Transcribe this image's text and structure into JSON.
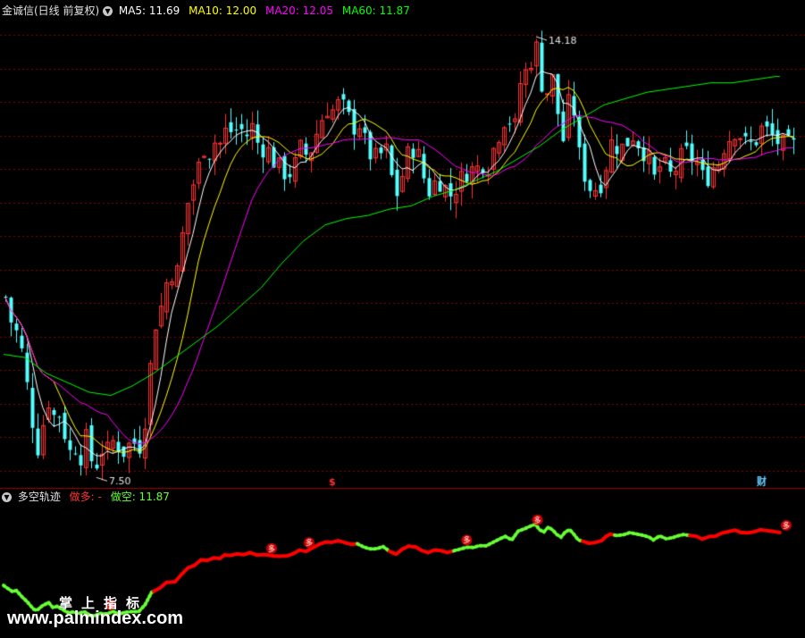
{
  "header": {
    "stock": "金诚信(日线 前复权)",
    "ma5": "MA5: 11.69",
    "ma10": "MA10: 12.00",
    "ma20": "MA20: 12.05",
    "ma60": "MA60: 11.87"
  },
  "indicator": {
    "name": "多空轨迹",
    "long_label": "做多: -",
    "short_label": "做空: 11.87"
  },
  "watermark": {
    "line1": "掌上指标",
    "line2": "www.palmindex.com"
  },
  "colors": {
    "up": "#ff3232",
    "down": "#54ffff",
    "ma5": "#ffffff",
    "ma10": "#ffff00",
    "ma20": "#ff00ff",
    "ma60": "#00ff00",
    "grid": "#8b0000",
    "long_line": "#ff0000",
    "short_line": "#66ff33"
  },
  "chart_data": {
    "type": "candlestick",
    "y_range": [
      7.2,
      14.6
    ],
    "max_label": "14.18",
    "min_label": "7.50",
    "markers": [
      "$",
      "财"
    ],
    "signal_label": "多",
    "price_control_points": [
      [
        0,
        10.2
      ],
      [
        8,
        9.6
      ],
      [
        12,
        9.7
      ],
      [
        17,
        9.1
      ],
      [
        22,
        8.6
      ],
      [
        28,
        7.9
      ],
      [
        31,
        7.8
      ],
      [
        36,
        8.3
      ],
      [
        42,
        8.7
      ],
      [
        46,
        8.2
      ],
      [
        50,
        8.35
      ],
      [
        55,
        8.05
      ],
      [
        60,
        7.75
      ],
      [
        65,
        7.85
      ],
      [
        70,
        7.7
      ],
      [
        75,
        7.95
      ],
      [
        82,
        7.5
      ],
      [
        86,
        7.6
      ],
      [
        90,
        7.8
      ],
      [
        96,
        7.75
      ],
      [
        102,
        8.0
      ],
      [
        108,
        7.7
      ],
      [
        113,
        7.85
      ],
      [
        120,
        7.9
      ],
      [
        126,
        7.85
      ],
      [
        132,
        8.5
      ],
      [
        138,
        9.7
      ],
      [
        146,
        10.1
      ],
      [
        152,
        10.6
      ],
      [
        160,
        10.6
      ],
      [
        166,
        11.3
      ],
      [
        172,
        11.9
      ],
      [
        178,
        12.1
      ],
      [
        184,
        12.6
      ],
      [
        190,
        12.5
      ],
      [
        196,
        12.7
      ],
      [
        202,
        12.6
      ],
      [
        206,
        12.9
      ],
      [
        212,
        12.8
      ],
      [
        218,
        12.9
      ],
      [
        224,
        12.75
      ],
      [
        230,
        12.9
      ],
      [
        236,
        12.6
      ],
      [
        244,
        12.55
      ],
      [
        252,
        12.3
      ],
      [
        258,
        12.2
      ],
      [
        264,
        12.15
      ],
      [
        270,
        12.3
      ],
      [
        276,
        12.6
      ],
      [
        282,
        12.4
      ],
      [
        288,
        12.7
      ],
      [
        294,
        13.0
      ],
      [
        300,
        13.2
      ],
      [
        306,
        13.15
      ],
      [
        312,
        13.3
      ],
      [
        318,
        13.1
      ],
      [
        324,
        12.9
      ],
      [
        330,
        12.95
      ],
      [
        336,
        12.6
      ],
      [
        342,
        12.4
      ],
      [
        348,
        12.4
      ],
      [
        354,
        12.6
      ],
      [
        360,
        12.1
      ],
      [
        366,
        11.8
      ],
      [
        372,
        12.3
      ],
      [
        378,
        12.6
      ],
      [
        384,
        12.5
      ],
      [
        390,
        12.1
      ],
      [
        396,
        11.85
      ],
      [
        402,
        12.1
      ],
      [
        408,
        12.0
      ],
      [
        414,
        11.8
      ],
      [
        420,
        11.95
      ],
      [
        426,
        12.1
      ],
      [
        432,
        12.25
      ],
      [
        438,
        12.2
      ],
      [
        444,
        12.35
      ],
      [
        450,
        12.3
      ],
      [
        456,
        12.6
      ],
      [
        462,
        12.9
      ],
      [
        468,
        13.15
      ],
      [
        474,
        12.75
      ],
      [
        480,
        13.6
      ],
      [
        486,
        13.8
      ],
      [
        492,
        14.05
      ],
      [
        496,
        14.18
      ],
      [
        500,
        13.6
      ],
      [
        504,
        13.35
      ],
      [
        508,
        13.8
      ],
      [
        512,
        13.5
      ],
      [
        516,
        13.0
      ],
      [
        520,
        12.7
      ],
      [
        524,
        13.2
      ],
      [
        528,
        13.4
      ],
      [
        532,
        12.9
      ],
      [
        536,
        12.3
      ],
      [
        540,
        12.15
      ],
      [
        546,
        11.9
      ],
      [
        552,
        11.95
      ],
      [
        558,
        12.1
      ],
      [
        562,
        12.5
      ],
      [
        566,
        12.7
      ],
      [
        572,
        12.55
      ],
      [
        578,
        12.6
      ],
      [
        584,
        12.8
      ],
      [
        590,
        12.65
      ],
      [
        596,
        12.5
      ],
      [
        602,
        12.3
      ],
      [
        606,
        12.0
      ],
      [
        612,
        12.4
      ],
      [
        618,
        12.1
      ],
      [
        624,
        12.2
      ],
      [
        628,
        12.35
      ],
      [
        634,
        12.5
      ],
      [
        640,
        12.4
      ],
      [
        646,
        12.3
      ],
      [
        652,
        12.0
      ],
      [
        658,
        12.25
      ],
      [
        664,
        12.3
      ],
      [
        670,
        12.6
      ],
      [
        676,
        12.75
      ],
      [
        682,
        12.9
      ],
      [
        688,
        12.65
      ],
      [
        694,
        12.6
      ],
      [
        700,
        12.7
      ],
      [
        706,
        12.9
      ],
      [
        712,
        12.8
      ],
      [
        718,
        12.7
      ],
      [
        724,
        12.6
      ]
    ],
    "ma60_control_points": [
      [
        0,
        9.3
      ],
      [
        20,
        9.25
      ],
      [
        40,
        9.0
      ],
      [
        60,
        8.85
      ],
      [
        80,
        8.7
      ],
      [
        100,
        8.65
      ],
      [
        120,
        8.8
      ],
      [
        140,
        9.0
      ],
      [
        160,
        9.25
      ],
      [
        180,
        9.5
      ],
      [
        200,
        9.75
      ],
      [
        220,
        10.05
      ],
      [
        240,
        10.35
      ],
      [
        260,
        10.75
      ],
      [
        280,
        11.1
      ],
      [
        300,
        11.35
      ],
      [
        320,
        11.45
      ],
      [
        340,
        11.5
      ],
      [
        360,
        11.6
      ],
      [
        380,
        11.65
      ],
      [
        400,
        11.8
      ],
      [
        420,
        11.9
      ],
      [
        440,
        12.05
      ],
      [
        460,
        12.2
      ],
      [
        480,
        12.4
      ],
      [
        500,
        12.6
      ],
      [
        520,
        12.85
      ],
      [
        540,
        13.05
      ],
      [
        560,
        13.25
      ],
      [
        580,
        13.35
      ],
      [
        600,
        13.45
      ],
      [
        620,
        13.5
      ],
      [
        640,
        13.55
      ],
      [
        660,
        13.6
      ],
      [
        680,
        13.6
      ],
      [
        700,
        13.65
      ],
      [
        720,
        13.7
      ],
      [
        724,
        13.7
      ]
    ],
    "signal_segments": [
      [
        0,
        140,
        "short"
      ],
      [
        140,
        330,
        "long"
      ],
      [
        330,
        360,
        "short"
      ],
      [
        360,
        420,
        "long"
      ],
      [
        420,
        540,
        "short"
      ],
      [
        540,
        570,
        "long"
      ],
      [
        570,
        640,
        "short"
      ],
      [
        640,
        724,
        "long"
      ]
    ],
    "signal_points": [
      100,
      250,
      285,
      432,
      498,
      730,
      838
    ],
    "marker_points": [
      364,
      843
    ]
  }
}
